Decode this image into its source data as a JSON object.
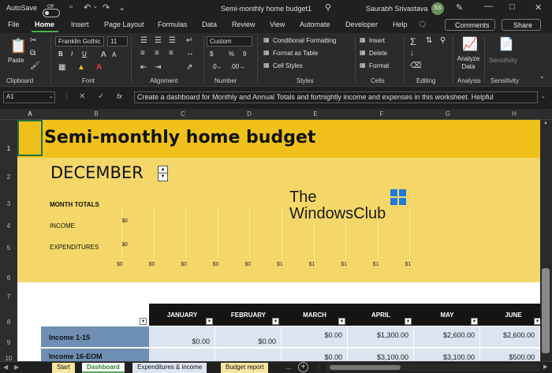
{
  "titlebar": {
    "autosave_label": "AutoSave",
    "autosave_state": "Off",
    "doc_title": "Semi-monthly home budget1",
    "user_name": "Saurabh Srivastava",
    "user_initials": "SS"
  },
  "menu": [
    "File",
    "Home",
    "Insert",
    "Page Layout",
    "Formulas",
    "Data",
    "Review",
    "View",
    "Automate",
    "Developer",
    "Help"
  ],
  "menu_active": "Home",
  "comments_label": "Comments",
  "share_label": "Share",
  "ribbon": {
    "paste_label": "Paste",
    "clipboard_label": "Clipboard",
    "font_name": "Franklin Gothic",
    "font_size": "11",
    "font_label": "Font",
    "alignment_label": "Alignment",
    "number_format": "Custom",
    "number_label": "Number",
    "conditional_formatting": "Conditional Formatting",
    "format_as_table": "Format as Table",
    "cell_styles": "Cell Styles",
    "styles_label": "Styles",
    "insert": "Insert",
    "delete": "Delete",
    "format": "Format",
    "cells_label": "Cells",
    "editing_label": "Editing",
    "analyze_data": "Analyze Data",
    "analysis_label": "Analysis",
    "sensitivity": "Sensitivity",
    "sensitivity_label": "Sensitivity",
    "dollar_sign": "$",
    "percent_sign": "%",
    "comma_sign": "9"
  },
  "formula_bar": {
    "cell_ref": "A1",
    "fx": "fx",
    "content": "Create a dashboard for Monthly and Annual Totals and fortnightly income and expenses in this worksheet. Helpful"
  },
  "columns": [
    "A",
    "B",
    "C",
    "D",
    "E",
    "F",
    "G",
    "H"
  ],
  "rows": [
    "1",
    "2",
    "3",
    "4",
    "5",
    "6",
    "7",
    "8",
    "9",
    "10"
  ],
  "sheet": {
    "title": "Semi-monthly home budget",
    "month": "DECEMBER",
    "month_totals": "MONTH TOTALS",
    "income": "INCOME",
    "expenditures": "EXPENDITURES",
    "income_value": "$0",
    "expenditures_value": "$0",
    "axis_labels": [
      "$0",
      "$0",
      "$0",
      "$0",
      "$0",
      "$1",
      "$1",
      "$1",
      "$1",
      "$1"
    ]
  },
  "watermark": {
    "line1": "The",
    "line2": "WindowsClub"
  },
  "table": {
    "months": [
      "JANUARY",
      "FEBRUARY",
      "MARCH",
      "APRIL",
      "MAY",
      "JUNE"
    ],
    "row1_label": "Income 1-15",
    "row1_values": [
      "$0.00",
      "$0.00",
      "$0.00",
      "$1,300.00",
      "$2,600.00",
      "$2,600.00"
    ],
    "row2_label": "Income 16-EOM",
    "row2_values": [
      "",
      "",
      "$0.00",
      "$3,100.00",
      "$3,100.00",
      "$500.00"
    ]
  },
  "tabs": [
    "Start",
    "Dashboard",
    "Expenditures & income",
    "Budget report"
  ],
  "active_tab": "Dashboard",
  "tab_more": "...",
  "tab_add": "+",
  "colors": {
    "title_band": "#f0c11a",
    "chart_band": "#f5d769",
    "table_header": "#141414",
    "row_label": "#6e8fb3",
    "cell_bg": "#dbe4ef",
    "active_tab_text": "#4caf50",
    "budget_tab": "#f5e6a0"
  },
  "icons": [
    "undo-icon",
    "redo-icon",
    "save-icon",
    "search-icon",
    "minimize-icon",
    "maximize-icon",
    "close-icon",
    "windows-logo-icon"
  ]
}
